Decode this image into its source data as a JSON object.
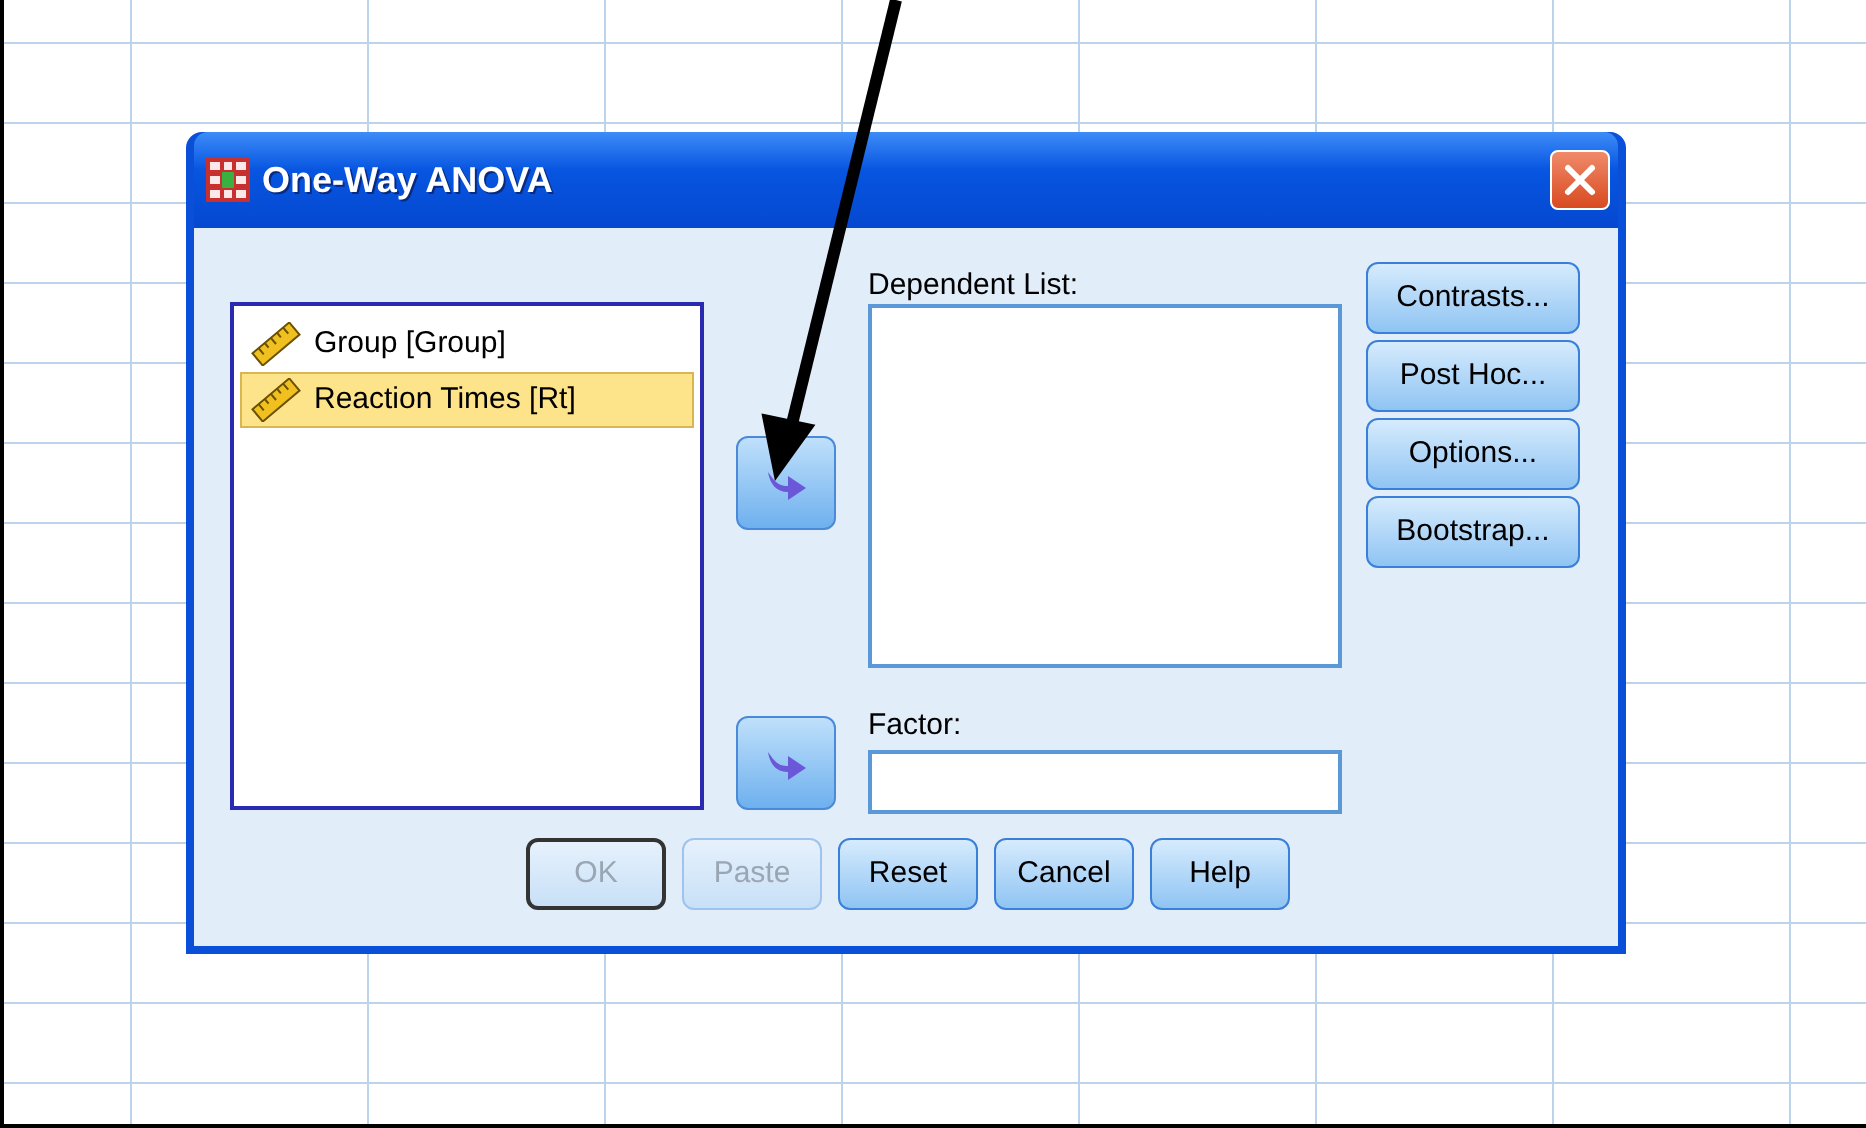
{
  "window": {
    "title": "One-Way ANOVA"
  },
  "variables": [
    {
      "label": "Group [Group]",
      "selected": false
    },
    {
      "label": "Reaction Times [Rt]",
      "selected": true
    }
  ],
  "dependent_list": {
    "label": "Dependent List:"
  },
  "factor": {
    "label": "Factor:"
  },
  "side_buttons": [
    {
      "label": "Contrasts..."
    },
    {
      "label": "Post Hoc..."
    },
    {
      "label": "Options..."
    },
    {
      "label": "Bootstrap..."
    }
  ],
  "bottom_buttons": [
    {
      "label": "OK",
      "disabled": true,
      "default": true
    },
    {
      "label": "Paste",
      "disabled": true,
      "default": false
    },
    {
      "label": "Reset",
      "disabled": false,
      "default": false
    },
    {
      "label": "Cancel",
      "disabled": false,
      "default": false
    },
    {
      "label": "Help",
      "disabled": false,
      "default": false
    }
  ]
}
